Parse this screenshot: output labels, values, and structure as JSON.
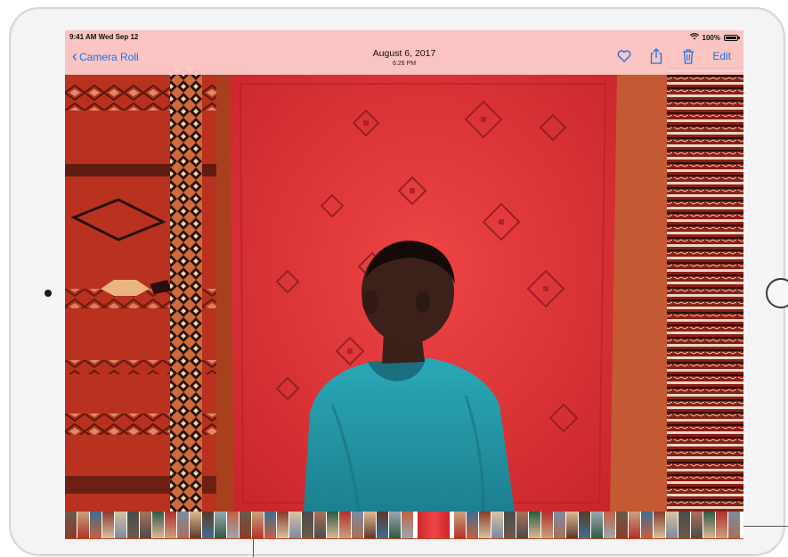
{
  "status_bar": {
    "time_date": "9:41 AM  Wed Sep 12",
    "battery": "100%"
  },
  "nav": {
    "back_label": "Camera Roll",
    "title": "August 6, 2017",
    "subtitle": "6:26 PM",
    "edit_label": "Edit"
  },
  "icons": {
    "back": "chevron-left-icon",
    "favorite": "heart-icon",
    "share": "share-icon",
    "delete": "trash-icon",
    "wifi": "wifi-icon",
    "battery": "battery-icon"
  },
  "colors": {
    "accent": "#1a73e8",
    "navbar_bg": "#ffcdcd",
    "rug_red": "#d8323a"
  },
  "filmstrip": {
    "thumbnail_count": 52,
    "current_index": 28
  }
}
